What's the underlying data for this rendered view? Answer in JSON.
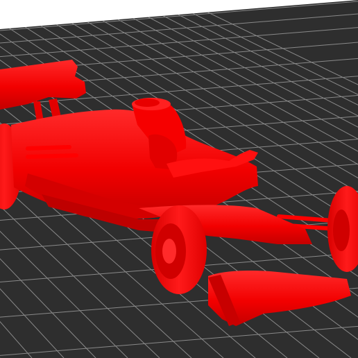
{
  "viewport": {
    "background_color": "#ffffff",
    "bed_color": "#2e2e2e",
    "grid_color": "#8a8a8a",
    "model_color": "#ff0000",
    "model_shade_color": "#c80000",
    "model_highlight_color": "#ff3a3a"
  },
  "model": {
    "subject": "formula-1-car",
    "parts": [
      "rear-wing",
      "rear-wheel",
      "body",
      "cockpit",
      "engine-cover",
      "front-suspension",
      "front-wheel-left",
      "front-wheel-right",
      "front-wing"
    ]
  }
}
